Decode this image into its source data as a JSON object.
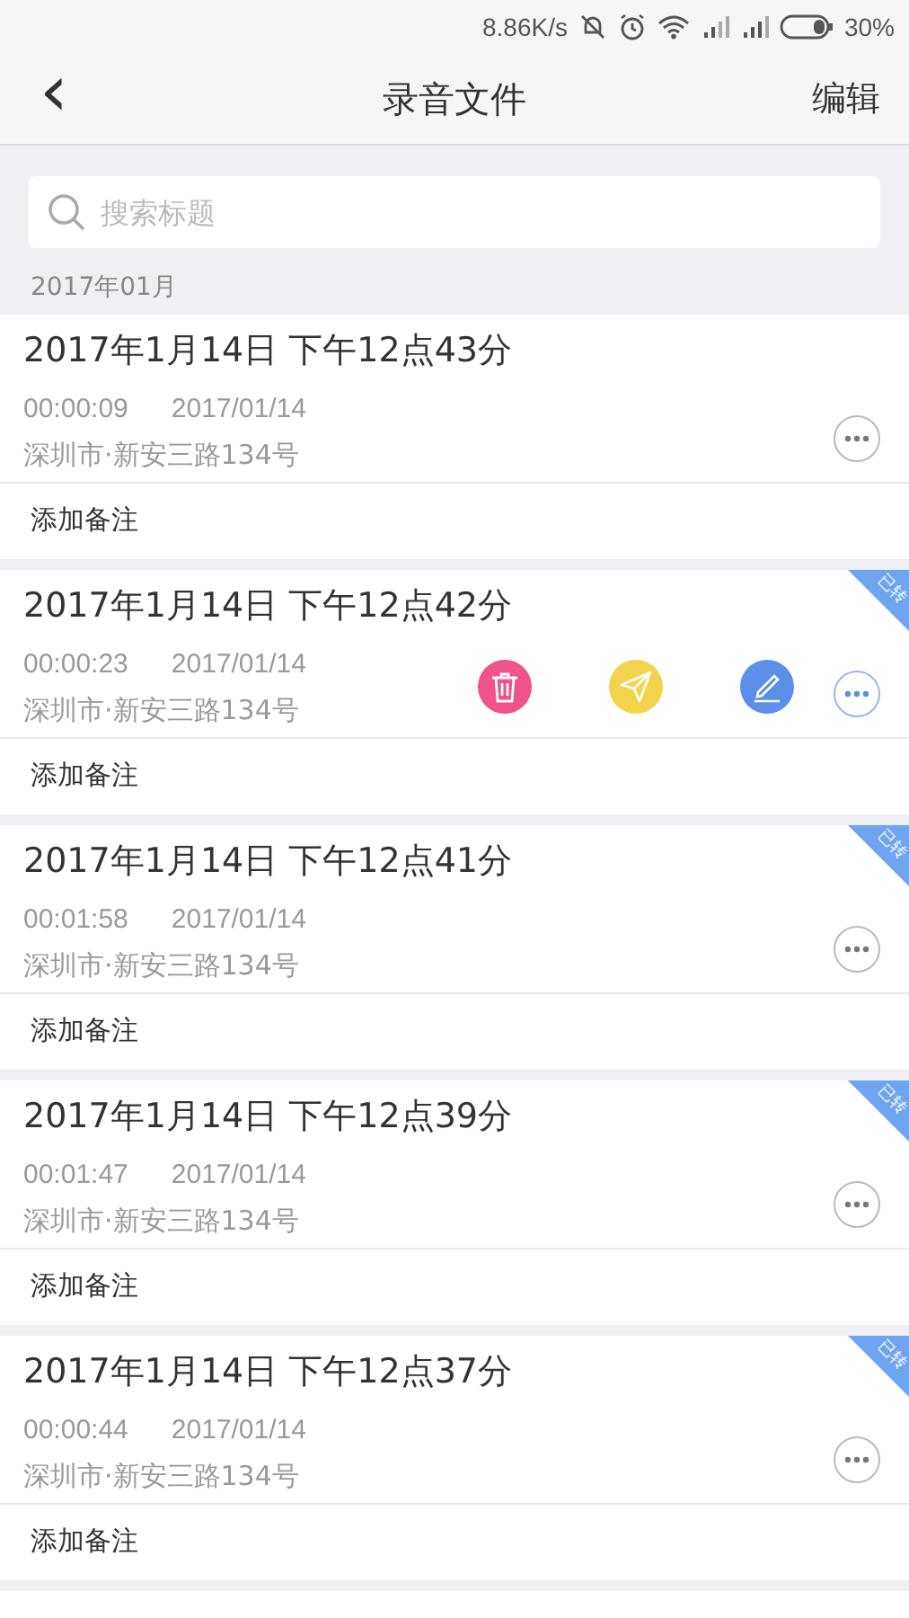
{
  "status_bar": {
    "speed": "8.86K/s",
    "battery": "30%"
  },
  "header": {
    "back": "‹",
    "title": "录音文件",
    "action": "编辑"
  },
  "search": {
    "placeholder": "搜索标题"
  },
  "month": "2017年01月",
  "records": [
    {
      "title": "2017年1月14日 下午12点43分",
      "duration": "00:00:09",
      "date": "2017/01/14",
      "address": "深圳市·新安三路134号",
      "note": "添加备注",
      "converted": false,
      "menu_open": false
    },
    {
      "title": "2017年1月14日 下午12点42分",
      "duration": "00:00:23",
      "date": "2017/01/14",
      "address": "深圳市·新安三路134号",
      "note": "添加备注",
      "converted": true,
      "ribbon": "已转",
      "menu_open": true
    },
    {
      "title": "2017年1月14日 下午12点41分",
      "duration": "00:01:58",
      "date": "2017/01/14",
      "address": "深圳市·新安三路134号",
      "note": "添加备注",
      "converted": true,
      "ribbon": "已转",
      "menu_open": false
    },
    {
      "title": "2017年1月14日 下午12点39分",
      "duration": "00:01:47",
      "date": "2017/01/14",
      "address": "深圳市·新安三路134号",
      "note": "添加备注",
      "converted": true,
      "ribbon": "已转",
      "menu_open": false
    },
    {
      "title": "2017年1月14日 下午12点37分",
      "duration": "00:00:44",
      "date": "2017/01/14",
      "address": "深圳市·新安三路134号",
      "note": "添加备注",
      "converted": true,
      "ribbon": "已转",
      "menu_open": false
    }
  ]
}
